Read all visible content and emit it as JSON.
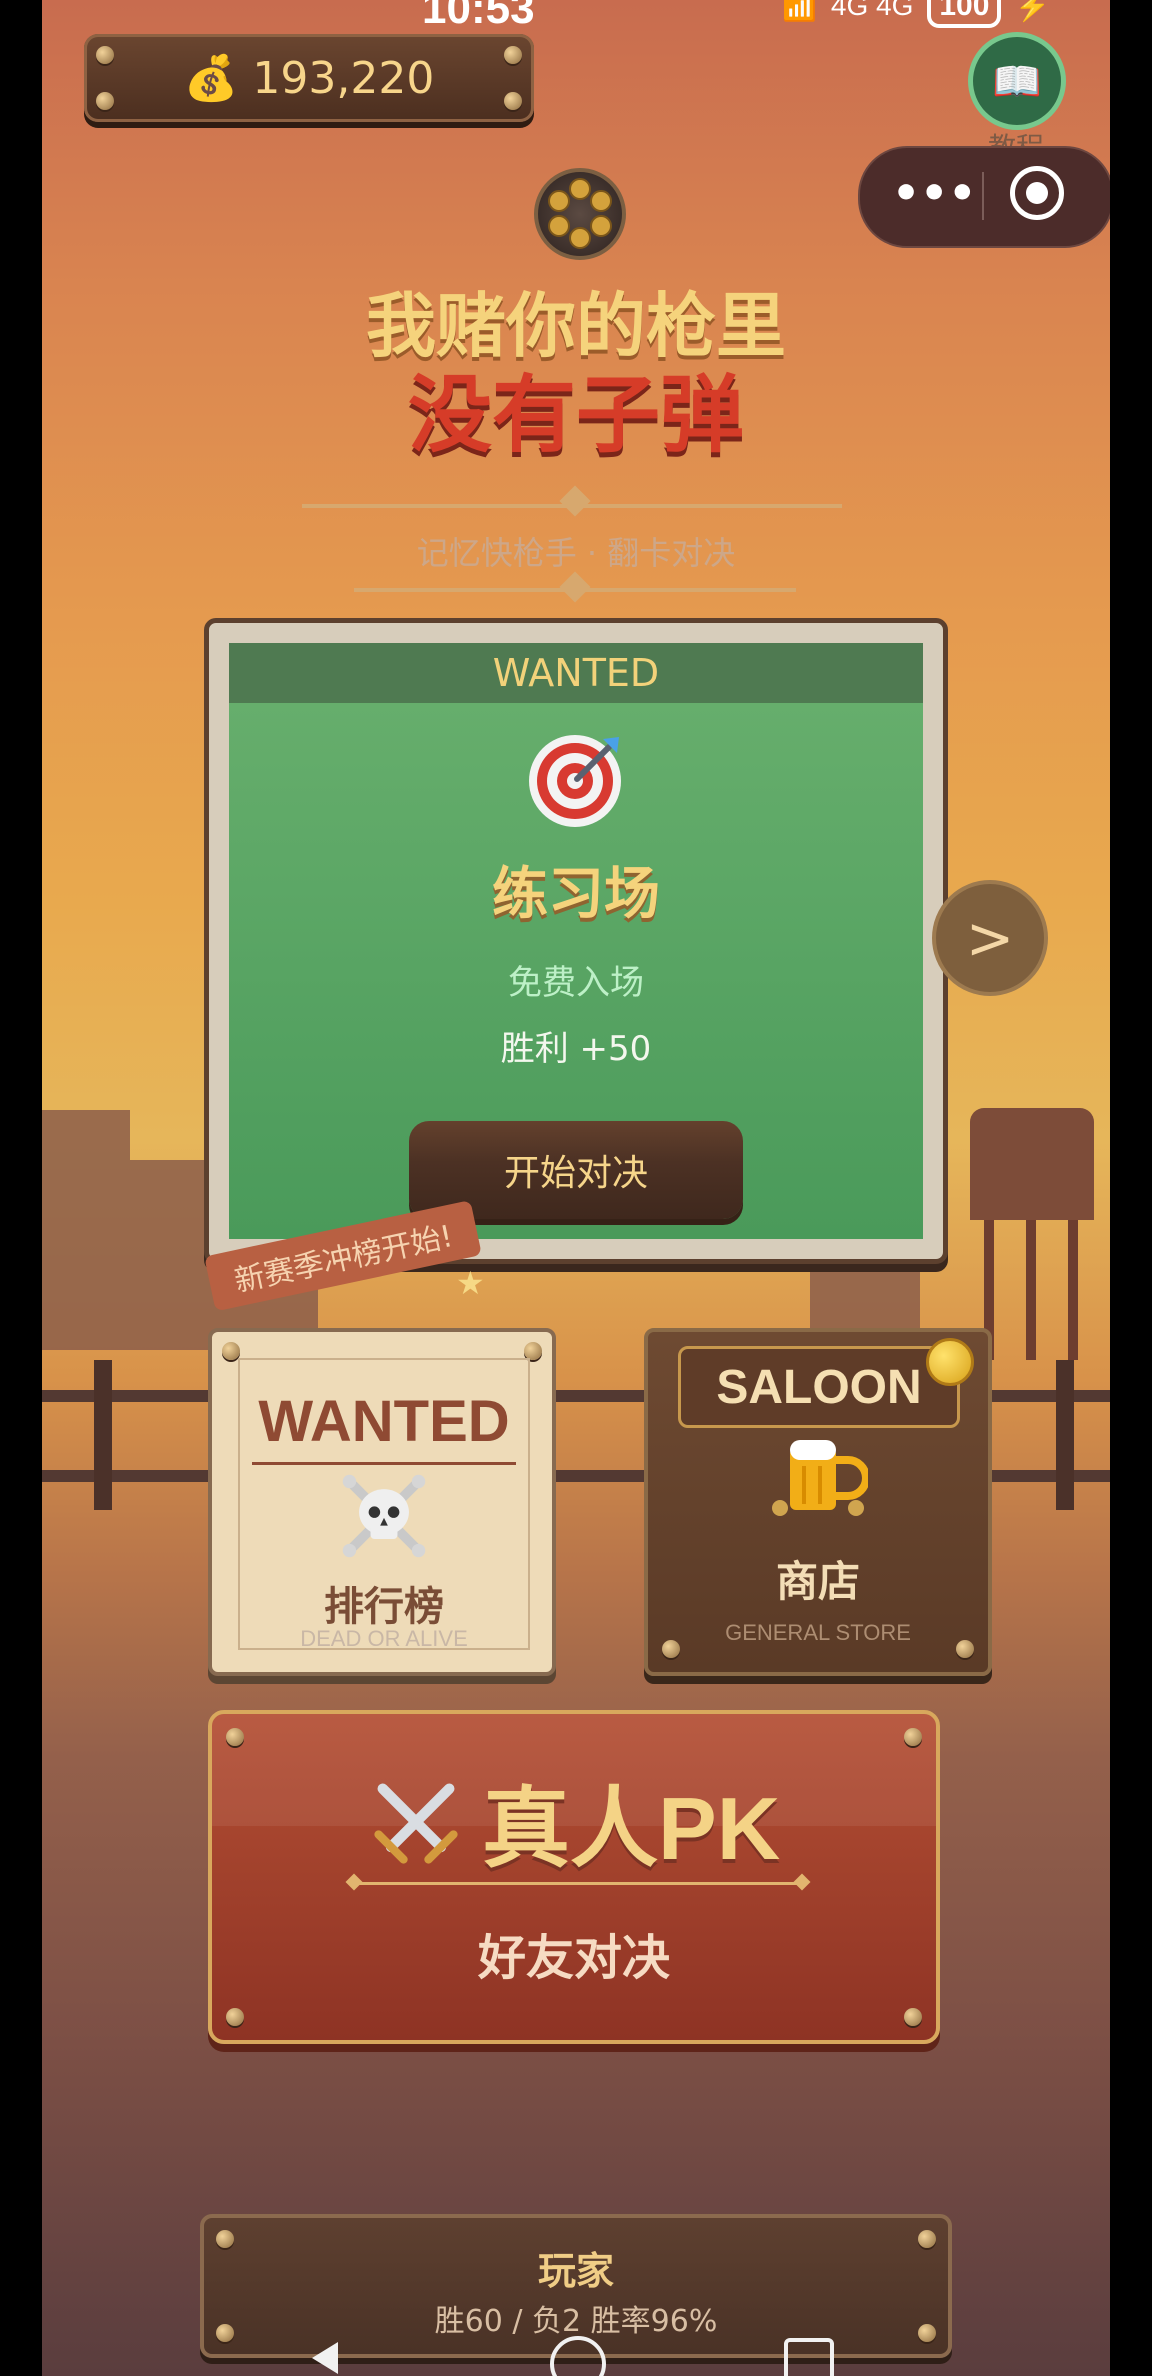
{
  "status_bar": {
    "time": "10:53",
    "icons": "4G 4G",
    "battery": "100"
  },
  "header": {
    "coins": "193,220",
    "tutorial_label": "教程"
  },
  "title": {
    "line1": "我赌你的枪里",
    "line2": "没有子弹",
    "subtitle": "记忆快枪手 · 翻卡对决"
  },
  "practice_card": {
    "header": "WANTED",
    "title": "练习场",
    "entry": "免费入场",
    "reward": "胜利 +50",
    "button": "开始对决",
    "next_arrow": ">"
  },
  "season_banner": {
    "text": "新赛季冲榜开始!"
  },
  "leaderboard_card": {
    "header": "WANTED",
    "label": "排行榜",
    "subtitle": "DEAD OR ALIVE"
  },
  "shop_card": {
    "header": "SALOON",
    "label": "商店",
    "subtitle": "GENERAL STORE"
  },
  "pk_card": {
    "title": "真人PK",
    "subtitle": "好友对决"
  },
  "player_panel": {
    "label": "玩家",
    "stats": "胜60 / 负2  胜率96%"
  },
  "icons": {
    "coin_bag": "money-bag-icon",
    "tutorial": "book-icon",
    "capsule_more": "more-icon",
    "capsule_target": "target-icon",
    "revolver": "revolver-icon",
    "practice": "target-dart-icon",
    "next": "chevron-right-icon",
    "rank": "skull-icon",
    "shop": "beer-icon",
    "pk": "swords-icon",
    "nav_back": "back-icon",
    "nav_home": "home-icon",
    "nav_recent": "recent-apps-icon"
  }
}
